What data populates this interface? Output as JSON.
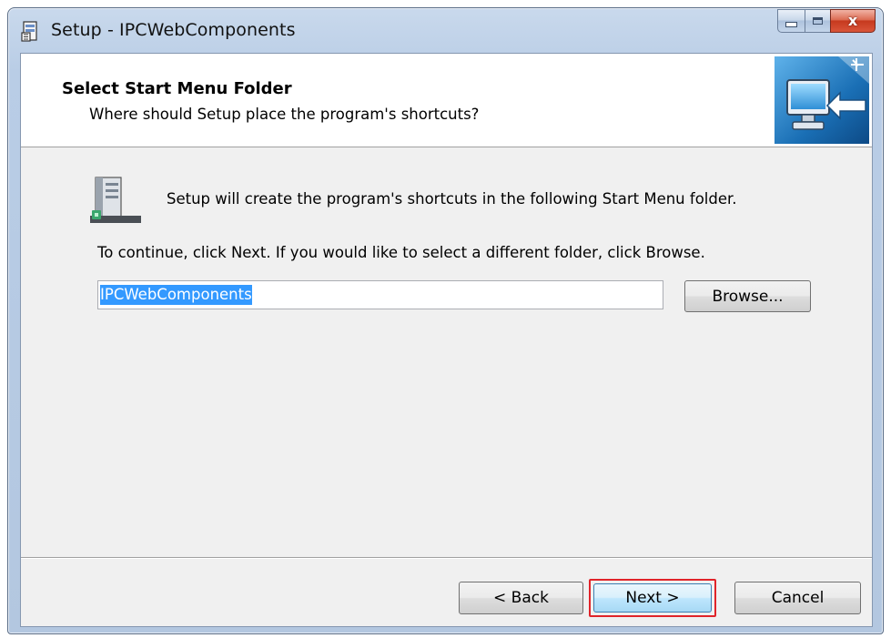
{
  "window": {
    "title": "Setup - IPCWebComponents",
    "close_glyph": "x"
  },
  "header": {
    "title": "Select Start Menu Folder",
    "subtitle": "Where should Setup place the program's shortcuts?"
  },
  "body": {
    "description": "Setup will create the program's shortcuts in the following Start Menu folder.",
    "instruction": "To continue, click Next. If you would like to select a different folder, click Browse.",
    "folder_value": "IPCWebComponents",
    "browse_label": "Browse..."
  },
  "footer": {
    "back_label": "< Back",
    "next_label": "Next >",
    "cancel_label": "Cancel"
  },
  "icons": {
    "app": "setup-app-icon",
    "wizard": "computer-shortcut-icon",
    "folder": "start-menu-folder-icon"
  },
  "colors": {
    "selection": "#3399ff",
    "highlight_border": "#e0242a",
    "close_button": "#c6391e",
    "wizard_bg": "#1a6fb5"
  }
}
